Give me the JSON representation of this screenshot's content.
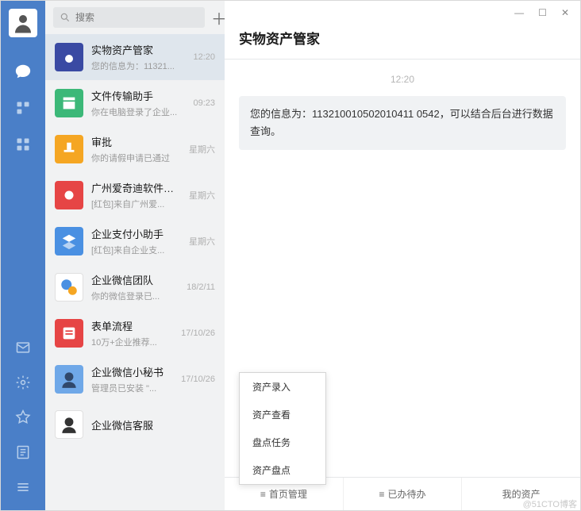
{
  "search": {
    "placeholder": "搜索"
  },
  "chat": {
    "title": "实物资产管家",
    "time": "12:20",
    "message": "您的信息为：113210010502010411 0542，可以结合后台进行数据查询。",
    "tabs": [
      "首页管理",
      "已办待办",
      "我的资产"
    ]
  },
  "popup": [
    "资产录入",
    "资产查看",
    "盘点任务",
    "资产盘点"
  ],
  "convs": [
    {
      "title": "实物资产管家",
      "sub": "您的信息为：11321...",
      "time": "12:20",
      "bg": "#3a4aa3"
    },
    {
      "title": "文件传输助手",
      "sub": "你在电脑登录了企业...",
      "time": "09:23",
      "bg": "#3cb878"
    },
    {
      "title": "审批",
      "sub": "你的请假申请已通过",
      "time": "星期六",
      "bg": "#f5a623"
    },
    {
      "title": "广州爱奇迪软件科技有...",
      "sub": "[红包]来自广州爱...",
      "time": "星期六",
      "bg": "#e64545"
    },
    {
      "title": "企业支付小助手",
      "sub": "[红包]来自企业支...",
      "time": "星期六",
      "bg": "#4a90e2"
    },
    {
      "title": "企业微信团队",
      "sub": "你的微信登录已...",
      "time": "18/2/11",
      "bg": "#ffffff"
    },
    {
      "title": "表单流程",
      "sub": "10万+企业推荐...",
      "time": "17/10/26",
      "bg": "#e64545"
    },
    {
      "title": "企业微信小秘书",
      "sub": "管理员已安装 \"...",
      "time": "17/10/26",
      "bg": "#6fa8e8"
    },
    {
      "title": "企业微信客服",
      "sub": "",
      "time": "",
      "bg": "#ffffff"
    }
  ],
  "watermark": "@51CTO博客"
}
